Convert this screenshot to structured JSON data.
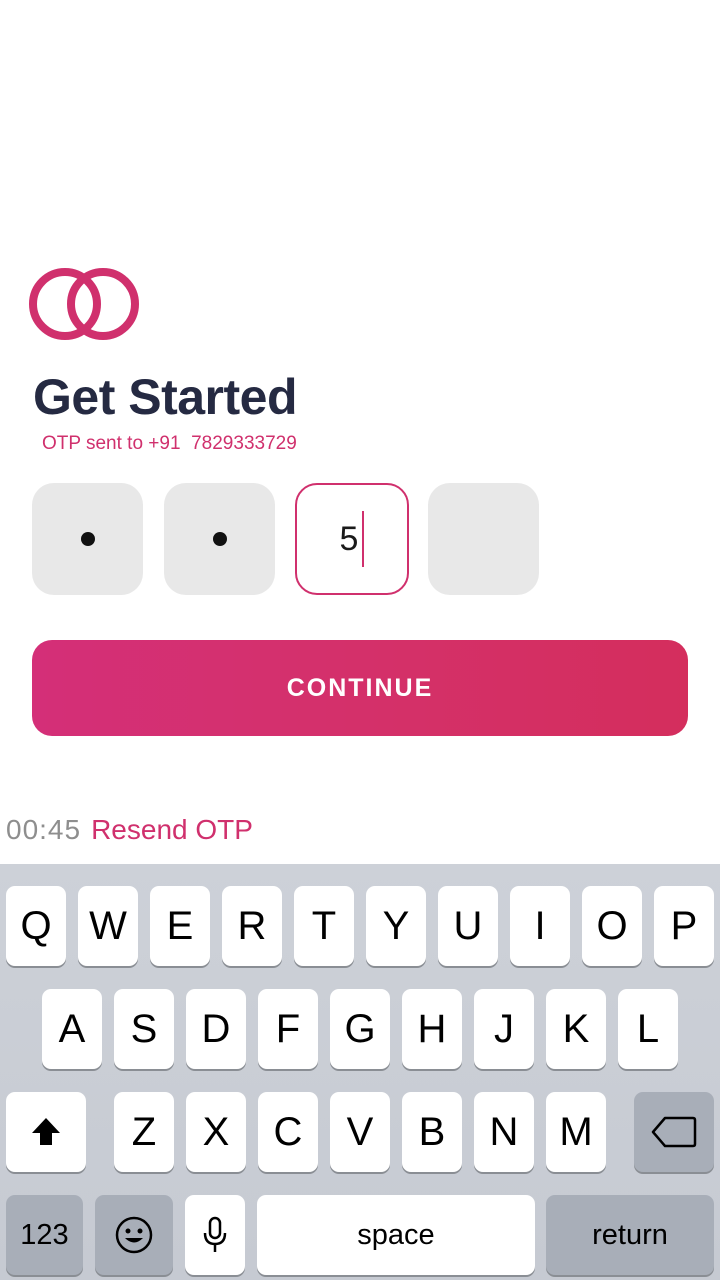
{
  "header": {
    "logo_icon": "interlocking-rings-icon",
    "title": "Get Started",
    "otp_sent_label": "OTP sent to +91",
    "phone_number": "7829333729"
  },
  "otp": {
    "boxes": [
      {
        "state": "masked"
      },
      {
        "state": "masked"
      },
      {
        "state": "active",
        "value": "5"
      },
      {
        "state": "empty"
      }
    ]
  },
  "actions": {
    "continue_label": "CONTINUE"
  },
  "resend": {
    "timer": "00:45",
    "label": "Resend OTP"
  },
  "keyboard": {
    "row1": [
      "Q",
      "W",
      "E",
      "R",
      "T",
      "Y",
      "U",
      "I",
      "O",
      "P"
    ],
    "row2": [
      "A",
      "S",
      "D",
      "F",
      "G",
      "H",
      "J",
      "K",
      "L"
    ],
    "row3": [
      "Z",
      "X",
      "C",
      "V",
      "B",
      "N",
      "M"
    ],
    "numbers_label": "123",
    "space_label": "space",
    "return_label": "return",
    "shift_icon": "shift-arrow-icon",
    "delete_icon": "backspace-icon",
    "emoji_icon": "emoji-face-icon",
    "mic_icon": "microphone-icon"
  },
  "colors": {
    "brand": "#d0306d",
    "title": "#252a42",
    "timer": "#8e8e8e"
  }
}
